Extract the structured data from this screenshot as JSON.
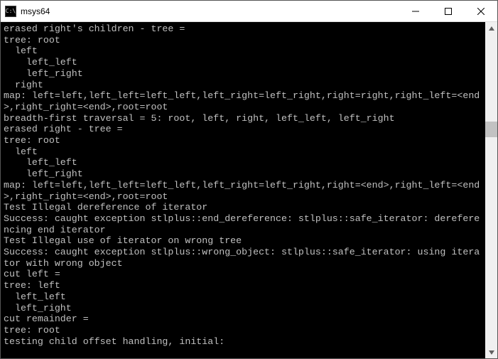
{
  "window": {
    "title": "msys64",
    "icon_glyph": "C:\\"
  },
  "terminal": {
    "lines": [
      "erased right's children - tree =",
      "tree: root",
      "  left",
      "    left_left",
      "    left_right",
      "  right",
      "map: left=left,left_left=left_left,left_right=left_right,right=right,right_left=<end>,right_right=<end>,root=root",
      "breadth-first traversal = 5: root, left, right, left_left, left_right",
      "erased right - tree =",
      "tree: root",
      "  left",
      "    left_left",
      "    left_right",
      "map: left=left,left_left=left_left,left_right=left_right,right=<end>,right_left=<end>,right_right=<end>,root=root",
      "Test Illegal dereference of iterator",
      "Success: caught exception stlplus::end_dereference: stlplus::safe_iterator: dereferencing end iterator",
      "Test Illegal use of iterator on wrong tree",
      "Success: caught exception stlplus::wrong_object: stlplus::safe_iterator: using iterator with wrong object",
      "cut left =",
      "tree: left",
      "  left_left",
      "  left_right",
      "cut remainder =",
      "tree: root",
      "testing child offset handling, initial:"
    ]
  }
}
